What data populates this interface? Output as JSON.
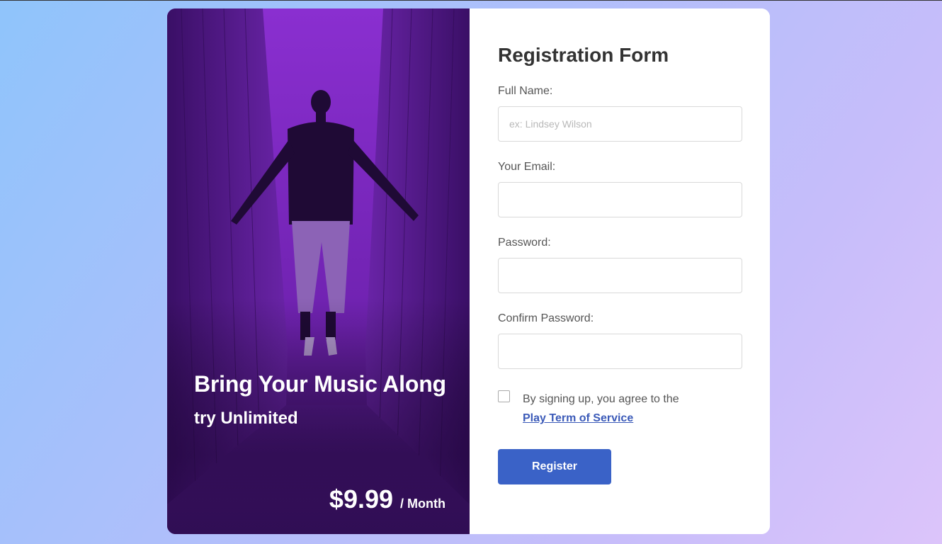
{
  "promo": {
    "headline": "Bring Your Music Along",
    "subline": "try Unlimited",
    "price": "$9.99",
    "period": "/ Month"
  },
  "form": {
    "title": "Registration Form",
    "full_name_label": "Full Name:",
    "full_name_placeholder": "ex: Lindsey Wilson",
    "email_label": "Your Email:",
    "password_label": "Password:",
    "confirm_password_label": "Confirm Password:",
    "terms_text": "By signing up, you agree to the",
    "terms_link": "Play Term of Service",
    "register_label": "Register"
  },
  "colors": {
    "accent": "#3a62c7",
    "promo_tint": "#5a1d9a",
    "link": "#3b5ab8"
  }
}
